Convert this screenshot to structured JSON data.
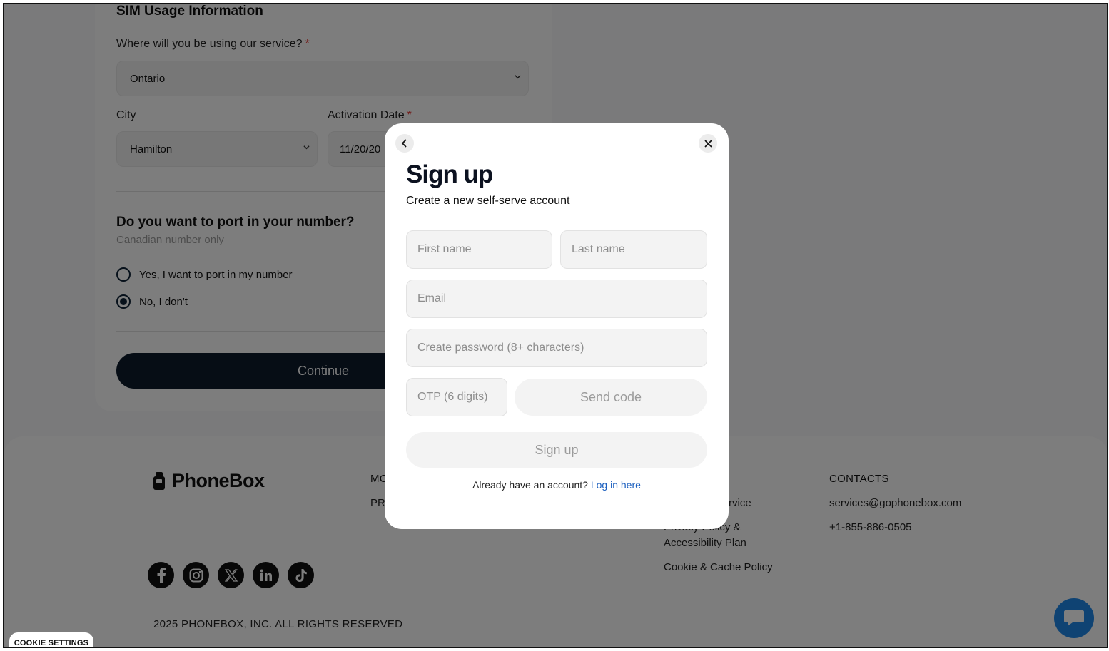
{
  "background": {
    "section_title": "SIM Usage Information",
    "service_question": "Where will you be using our service?",
    "required_mark": "*",
    "province_value": "Ontario",
    "city_label": "City",
    "city_value": "Hamilton",
    "activation_label": "Activation Date",
    "activation_value": "11/20/20",
    "port_title": "Do you want to port in your number?",
    "port_subtitle": "Canadian number only",
    "radio_yes": "Yes, I want to port in my number",
    "radio_no": "No, I don't",
    "continue_label": "Continue"
  },
  "footer": {
    "brand": "PhoneBox",
    "col2_head_partial": "MC",
    "col2_link_partial": "PR",
    "legal_links": [
      "rvice",
      "Privacy Policy &",
      "Accessibility Plan",
      "Cookie & Cache Policy"
    ],
    "contacts_head": "CONTACTS",
    "email": "services@gophonebox.com",
    "phone": "+1-855-886-0505",
    "social_icons": [
      "facebook-icon",
      "instagram-icon",
      "x-icon",
      "linkedin-icon",
      "tiktok-icon"
    ],
    "copyright": "2025 PHONEBOX, INC. ALL RIGHTS RESERVED",
    "cookie_settings": "COOKIE SETTINGS"
  },
  "modal": {
    "title": "Sign up",
    "subtitle": "Create a new self-serve account",
    "first_name_placeholder": "First name",
    "last_name_placeholder": "Last name",
    "email_placeholder": "Email",
    "password_placeholder": "Create password (8+ characters)",
    "otp_placeholder": "OTP (6 digits)",
    "send_code_label": "Send code",
    "signup_label": "Sign up",
    "have_account_text": "Already have an account?",
    "login_link": "Log in here"
  },
  "colors": {
    "primary_dark": "#0c1a2b",
    "link_blue": "#1b5fbf",
    "chat_blue": "#1e86e6",
    "required_red": "#e53935"
  }
}
